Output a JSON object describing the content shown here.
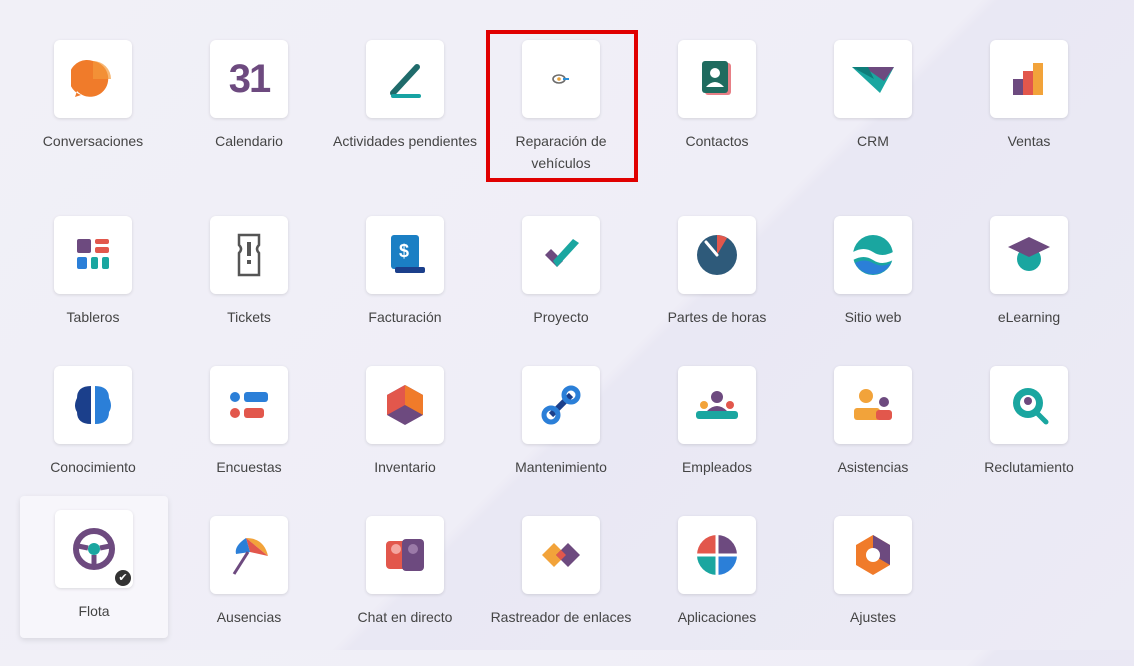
{
  "apps": [
    {
      "label": "Conversaciones",
      "icon": "conversations-icon"
    },
    {
      "label": "Calendario",
      "icon": "calendar-icon",
      "icon_text": "31"
    },
    {
      "label": "Actividades pendientes",
      "icon": "activities-icon"
    },
    {
      "label": "Reparación de vehículos",
      "icon": "vehicle-repair-icon"
    },
    {
      "label": "Contactos",
      "icon": "contacts-icon"
    },
    {
      "label": "CRM",
      "icon": "crm-icon"
    },
    {
      "label": "Ventas",
      "icon": "sales-icon"
    },
    {
      "label": "Tableros",
      "icon": "dashboards-icon"
    },
    {
      "label": "Tickets",
      "icon": "tickets-icon"
    },
    {
      "label": "Facturación",
      "icon": "invoicing-icon",
      "icon_text": "$"
    },
    {
      "label": "Proyecto",
      "icon": "project-icon"
    },
    {
      "label": "Partes de horas",
      "icon": "timesheets-icon"
    },
    {
      "label": "Sitio web",
      "icon": "website-icon"
    },
    {
      "label": "eLearning",
      "icon": "elearning-icon"
    },
    {
      "label": "Conocimiento",
      "icon": "knowledge-icon"
    },
    {
      "label": "Encuestas",
      "icon": "surveys-icon"
    },
    {
      "label": "Inventario",
      "icon": "inventory-icon"
    },
    {
      "label": "Mantenimiento",
      "icon": "maintenance-icon"
    },
    {
      "label": "Empleados",
      "icon": "employees-icon"
    },
    {
      "label": "Asistencias",
      "icon": "attendances-icon"
    },
    {
      "label": "Reclutamiento",
      "icon": "recruitment-icon"
    },
    {
      "label": "Flota",
      "icon": "fleet-icon"
    },
    {
      "label": "Ausencias",
      "icon": "time-off-icon"
    },
    {
      "label": "Chat en directo",
      "icon": "live-chat-icon"
    },
    {
      "label": "Rastreador de enlaces",
      "icon": "link-tracker-icon"
    },
    {
      "label": "Aplicaciones",
      "icon": "apps-icon"
    },
    {
      "label": "Ajustes",
      "icon": "settings-icon"
    }
  ],
  "colors": {
    "highlight": "#e00000",
    "accent": "#714b67"
  }
}
